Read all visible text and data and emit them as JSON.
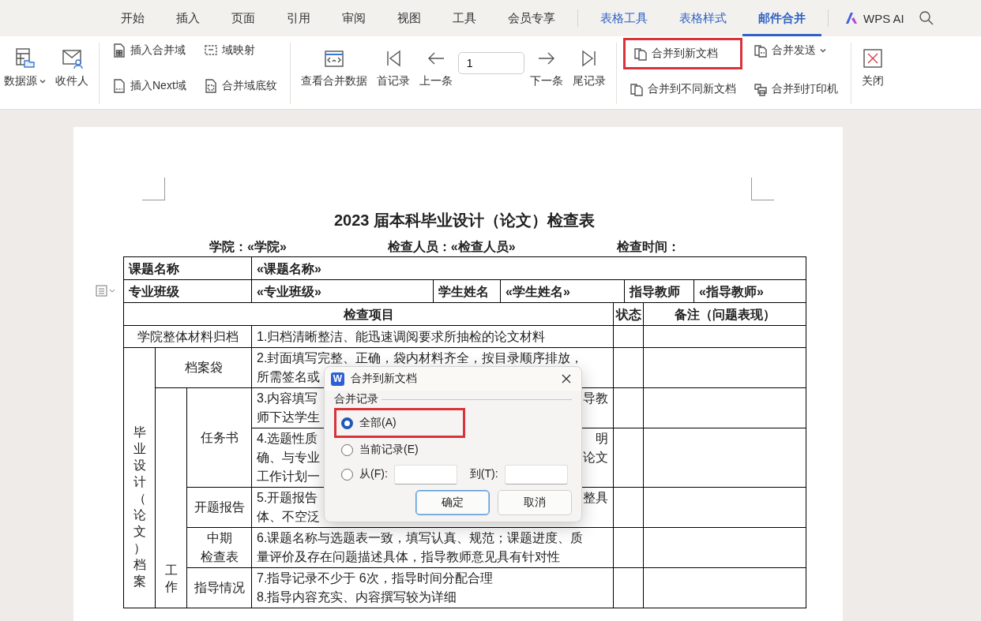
{
  "menu_tabs": [
    {
      "label": "开始",
      "selected": false,
      "kind": "plain"
    },
    {
      "label": "插入",
      "selected": false,
      "kind": "plain"
    },
    {
      "label": "页面",
      "selected": false,
      "kind": "plain"
    },
    {
      "label": "引用",
      "selected": false,
      "kind": "plain"
    },
    {
      "label": "审阅",
      "selected": false,
      "kind": "plain"
    },
    {
      "label": "视图",
      "selected": false,
      "kind": "plain"
    },
    {
      "label": "工具",
      "selected": false,
      "kind": "plain"
    },
    {
      "label": "会员专享",
      "selected": false,
      "kind": "plain"
    },
    {
      "label": "表格工具",
      "selected": false,
      "kind": "context"
    },
    {
      "label": "表格样式",
      "selected": false,
      "kind": "context"
    },
    {
      "label": "邮件合并",
      "selected": true,
      "kind": "context"
    }
  ],
  "ai_button": {
    "label": "WPS AI"
  },
  "ribbon": [
    {
      "kind": "row",
      "items": [
        {
          "kind": "large",
          "label": "数据源",
          "dropdown": true
        },
        {
          "kind": "large",
          "label": "收件人",
          "dropdown": false
        }
      ]
    },
    {
      "kind": "grid",
      "items": [
        {
          "kind": "small",
          "label": "插入合并域",
          "highlighted": false,
          "dropdown": false
        },
        {
          "kind": "small",
          "label": "插入Next域",
          "highlighted": false,
          "dropdown": false
        },
        {
          "kind": "small",
          "label": "域映射",
          "highlighted": false,
          "dropdown": false
        },
        {
          "kind": "small",
          "label": "合并域底纹",
          "highlighted": false,
          "dropdown": false
        }
      ]
    },
    {
      "kind": "row",
      "items": [
        {
          "kind": "large",
          "label": "查看合并数据",
          "dropdown": false
        },
        {
          "kind": "large",
          "label": "首记录",
          "dropdown": false
        },
        {
          "kind": "large",
          "label": "上一条",
          "dropdown": false
        },
        {
          "kind": "field",
          "value": "1"
        },
        {
          "kind": "large",
          "label": "下一条",
          "dropdown": false
        },
        {
          "kind": "large",
          "label": "尾记录",
          "dropdown": false
        }
      ]
    },
    {
      "kind": "grid",
      "items": [
        {
          "kind": "small",
          "label": "合并到新文档",
          "highlighted": true,
          "dropdown": false
        },
        {
          "kind": "small",
          "label": "合并到不同新文档",
          "highlighted": false,
          "dropdown": false
        },
        {
          "kind": "small",
          "label": "合并发送",
          "highlighted": false,
          "dropdown": true
        },
        {
          "kind": "small",
          "label": "合并到打印机",
          "highlighted": false,
          "dropdown": false
        }
      ]
    },
    {
      "kind": "row",
      "items": [
        {
          "kind": "large",
          "label": "关闭",
          "dropdown": false
        }
      ]
    }
  ],
  "document": {
    "title": "2023 届本科毕业设计（论文）检查表",
    "info": [
      "学院：«学院»",
      "检查人员：«检查人员»",
      "检查时间："
    ],
    "table": {
      "course": {
        "label": "课题名称",
        "value": "«课题名称»"
      },
      "class_row": [
        "专业班级",
        "«专业班级»",
        "学生姓名",
        "«学生姓名»",
        "指导教师",
        "«指导教师»"
      ],
      "columns": [
        "检查项目",
        "状态",
        "备注（问题表现）"
      ],
      "archive": {
        "category": "学院整体材料归档",
        "requirement": "1.归档清晰整洁、能迅速调阅要求所抽检的论文材料"
      },
      "section": {
        "name": "毕业设计（论文）档案",
        "entries": [
          {
            "name": [
              "档案袋"
            ],
            "cells": [
              {
                "lines": [
                  {
                    "left": "2.封面填写完整、正确，袋内材料齐全，按目录顺序排放，"
                  },
                  {
                    "left": "所需签名或"
                  }
                ]
              }
            ]
          }
        ],
        "subsection": {
          "name": "工作",
          "entries": [
            {
              "name": [
                "任务书"
              ],
              "cells": [
                {
                  "lines": [
                    {
                      "left": "3.内容填写",
                      "right": "导教"
                    },
                    {
                      "left": "师下达学生"
                    }
                  ]
                },
                {
                  "lines": [
                    {
                      "left": "4.选题性质",
                      "right": "明"
                    },
                    {
                      "left": "确、与专业",
                      "right": "论文"
                    },
                    {
                      "left": "工作计划一"
                    }
                  ]
                }
              ]
            },
            {
              "name": [
                "开题报告"
              ],
              "cells": [
                {
                  "lines": [
                    {
                      "left": "5.开题报告",
                      "right": "整具"
                    },
                    {
                      "left": "体、不空泛"
                    }
                  ]
                }
              ]
            },
            {
              "name": [
                "中期",
                "检查表"
              ],
              "cells": [
                {
                  "lines": [
                    {
                      "left": "6.课题名称与选题表一致，填写认真、规范；课题进度、质"
                    },
                    {
                      "left": "量评价及存在问题描述具体，指导教师意见具有针对性"
                    }
                  ]
                }
              ]
            },
            {
              "name": [
                "指导情况"
              ],
              "cells": [
                {
                  "lines": [
                    {
                      "left": "7.指导记录不少于 6次，指导时间分配合理"
                    },
                    {
                      "left": "8.指导内容充实、内容撰写较为详细"
                    }
                  ]
                }
              ]
            }
          ]
        }
      }
    }
  },
  "dialog": {
    "app_letter": "W",
    "title": "合并到新文档",
    "group_label": "合并记录",
    "options": [
      {
        "kind": "plain",
        "label": "全部(A)",
        "selected": true,
        "highlighted": true
      },
      {
        "kind": "plain",
        "label": "当前记录(E)",
        "selected": false,
        "highlighted": false
      },
      {
        "kind": "range",
        "label": "从(F):",
        "selected": false,
        "highlighted": false,
        "to_label": "到(T):"
      }
    ],
    "buttons": [
      {
        "label": "确定",
        "default": true
      },
      {
        "label": "取消",
        "default": false
      }
    ]
  }
}
